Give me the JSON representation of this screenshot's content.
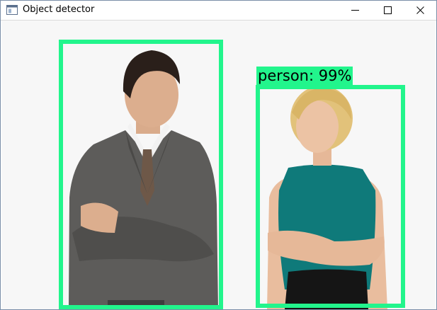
{
  "window": {
    "title": "Object detector",
    "controls": {
      "minimize_icon": "minimize-icon",
      "maximize_icon": "maximize-icon",
      "close_icon": "close-icon"
    }
  },
  "detections": [
    {
      "label": "",
      "box_color": "#22f58c"
    },
    {
      "label": "person: 99%",
      "box_color": "#22f58c"
    }
  ],
  "colors": {
    "box": "#22f58c",
    "canvas_bg": "#f7f7f7",
    "suit": "#5d5c5a",
    "top_teal": "#0f7a7a"
  }
}
